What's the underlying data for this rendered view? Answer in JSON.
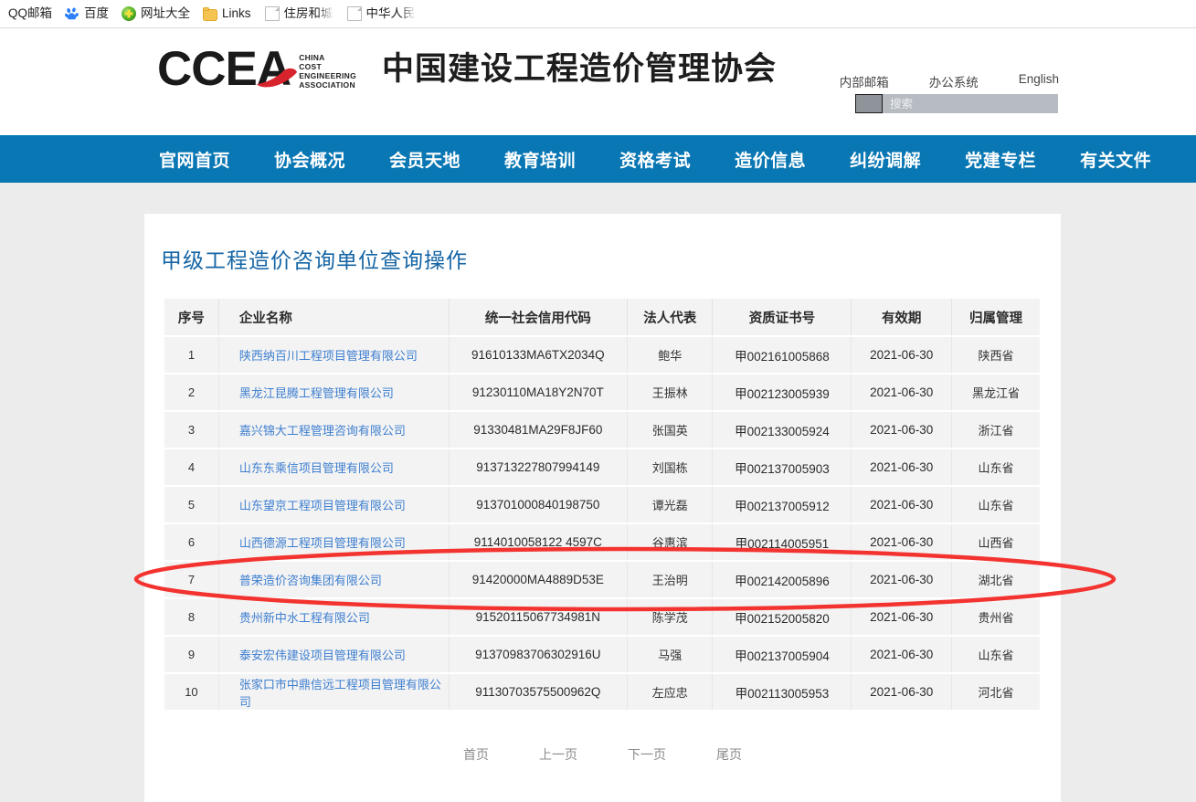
{
  "browser": {
    "bookmarks": [
      {
        "label": "QQ邮箱",
        "icon": "qq-mail-icon"
      },
      {
        "label": "百度",
        "icon": "baidu-icon"
      },
      {
        "label": "网址大全",
        "icon": "hao123-icon"
      },
      {
        "label": "Links",
        "icon": "folder-icon"
      },
      {
        "label": "住房和城",
        "icon": "page-icon"
      },
      {
        "label": "中华人民",
        "icon": "page-icon"
      }
    ]
  },
  "header": {
    "logo_text": "CCEA",
    "logo_sub_lines": [
      "CHINA",
      "COST",
      "ENGINEERING",
      "ASSOCIATION"
    ],
    "org_name": "中国建设工程造价管理协会",
    "links": [
      "内部邮箱",
      "办公系统",
      "English"
    ],
    "search": {
      "placeholder": "搜索",
      "value": ""
    },
    "accent_blue": "#0977b3",
    "logo_red": "#d7232b"
  },
  "nav": {
    "items": [
      "官网首页",
      "协会概况",
      "会员天地",
      "教育培训",
      "资格考试",
      "造价信息",
      "纠纷调解",
      "党建专栏",
      "有关文件"
    ]
  },
  "main": {
    "title": "甲级工程造价咨询单位查询操作",
    "table": {
      "columns": [
        "序号",
        "企业名称",
        "统一社会信用代码",
        "法人代表",
        "资质证书号",
        "有效期",
        "归属管理"
      ],
      "rows": [
        {
          "idx": "1",
          "name": "陕西纳百川工程项目管理有限公司",
          "code": "91610133MA6TX2034Q",
          "rep": "鲍华",
          "cert": "甲002161005868",
          "valid": "2021-06-30",
          "region": "陕西省"
        },
        {
          "idx": "2",
          "name": "黑龙江昆腾工程管理有限公司",
          "code": "91230110MA18Y2N70T",
          "rep": "王振林",
          "cert": "甲002123005939",
          "valid": "2021-06-30",
          "region": "黑龙江省"
        },
        {
          "idx": "3",
          "name": "嘉兴锦大工程管理咨询有限公司",
          "code": "91330481MA29F8JF60",
          "rep": "张国英",
          "cert": "甲002133005924",
          "valid": "2021-06-30",
          "region": "浙江省"
        },
        {
          "idx": "4",
          "name": "山东东乘信项目管理有限公司",
          "code": "913713227807994149",
          "rep": "刘国栋",
          "cert": "甲002137005903",
          "valid": "2021-06-30",
          "region": "山东省"
        },
        {
          "idx": "5",
          "name": "山东望京工程项目管理有限公司",
          "code": "913701000840198750",
          "rep": "谭光磊",
          "cert": "甲002137005912",
          "valid": "2021-06-30",
          "region": "山东省"
        },
        {
          "idx": "6",
          "name": "山西德源工程项目管理有限公司",
          "code": "9114010058122 4597C",
          "rep": "谷惠滨",
          "cert": "甲002114005951",
          "valid": "2021-06-30",
          "region": "山西省"
        },
        {
          "idx": "7",
          "name": "普荣造价咨询集团有限公司",
          "code": "91420000MA4889D53E",
          "rep": "王治明",
          "cert": "甲002142005896",
          "valid": "2021-06-30",
          "region": "湖北省"
        },
        {
          "idx": "8",
          "name": "贵州新中水工程有限公司",
          "code": "91520115067734981N",
          "rep": "陈学茂",
          "cert": "甲002152005820",
          "valid": "2021-06-30",
          "region": "贵州省"
        },
        {
          "idx": "9",
          "name": "泰安宏伟建设项目管理有限公司",
          "code": "91370983706302916U",
          "rep": "马强",
          "cert": "甲002137005904",
          "valid": "2021-06-30",
          "region": "山东省"
        },
        {
          "idx": "10",
          "name": "张家口市中鼎信远工程项目管理有限公司",
          "code": "91130703575500962Q",
          "rep": "左应忠",
          "cert": "甲002113005953",
          "valid": "2021-06-30",
          "region": "河北省"
        }
      ]
    },
    "pagination": [
      "首页",
      "上一页",
      "下一页",
      "尾页"
    ]
  },
  "annotation": {
    "shape": "ellipse",
    "color": "#f3332f",
    "highlights_row": "7"
  }
}
